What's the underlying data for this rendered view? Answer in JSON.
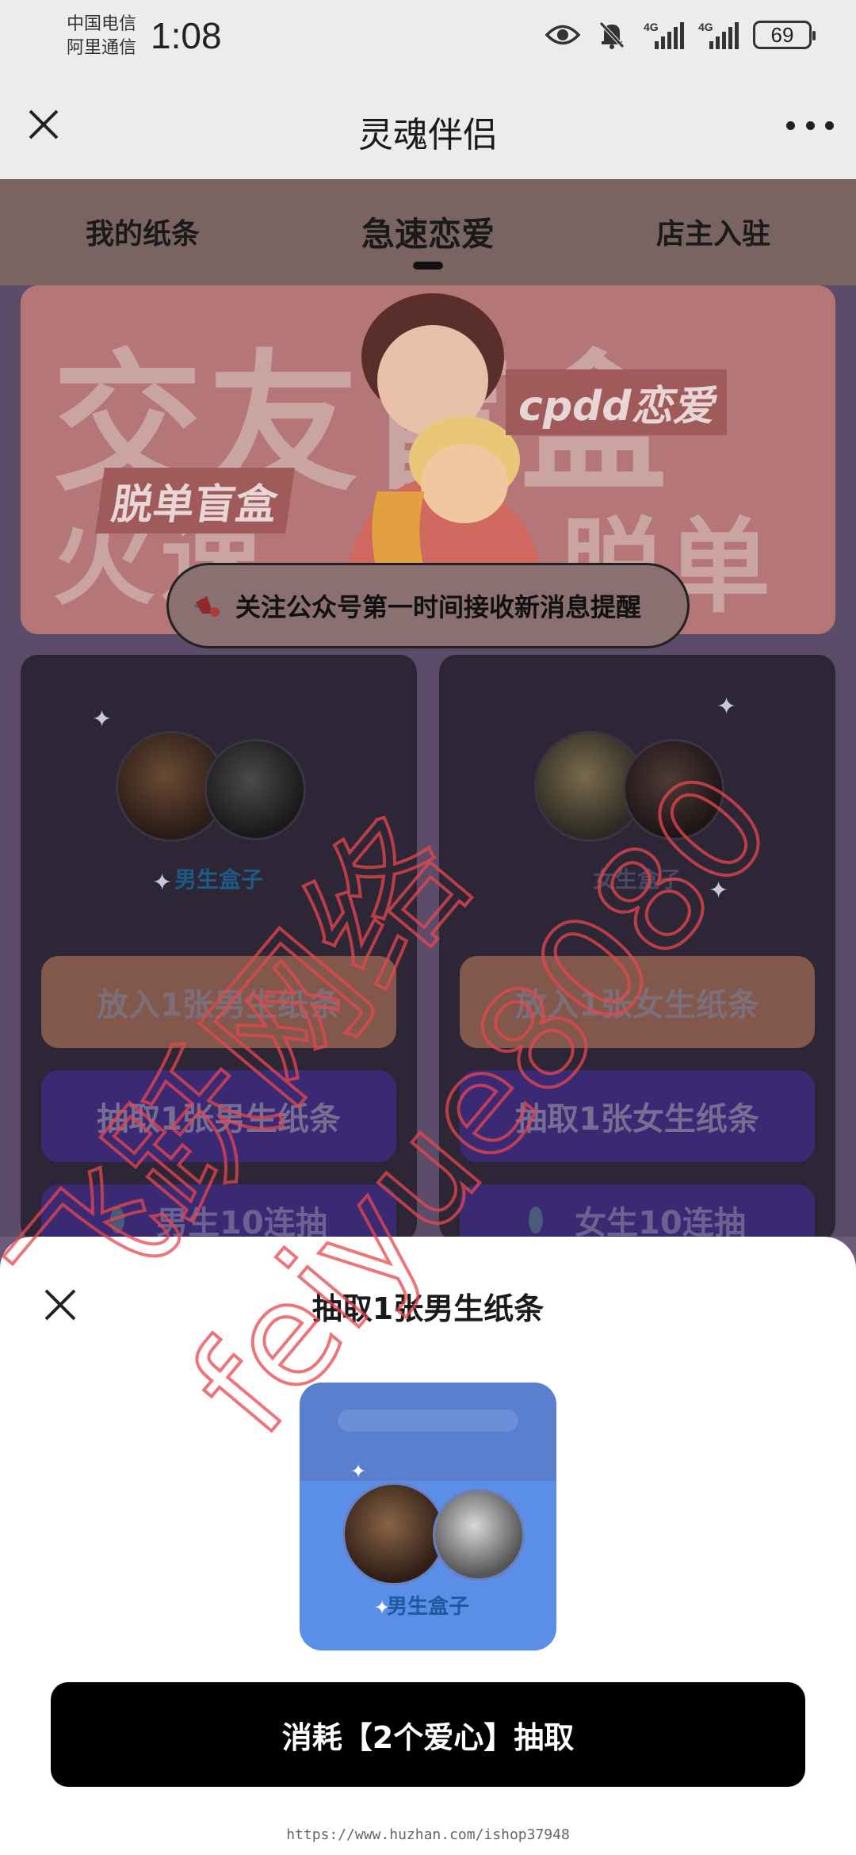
{
  "status_bar": {
    "carrier1": "中国电信",
    "carrier2": "阿里通信",
    "time": "1:08",
    "signal_tag": "4G",
    "battery": "69"
  },
  "header": {
    "title": "灵魂伴侣"
  },
  "tabs": [
    {
      "label": "我的纸条"
    },
    {
      "label": "急速恋爱"
    },
    {
      "label": "店主入驻"
    }
  ],
  "banner": {
    "big_text_1": "交友盲盒",
    "big_text_2": "火速",
    "big_text_3": "脱单",
    "tag_left": "脱单盲盒",
    "tag_right": "cpdd恋爱",
    "notice": "关注公众号第一时间接收新消息提醒"
  },
  "male_box": {
    "label": "男生盒子",
    "put_button": "放入1张男生纸条",
    "draw_button": "抽取1张男生纸条",
    "ten_button": "男生10连抽"
  },
  "female_box": {
    "label": "女生盒子",
    "put_button": "放入1张女生纸条",
    "draw_button": "抽取1张女生纸条",
    "ten_button": "女生10连抽"
  },
  "sheet": {
    "title": "抽取1张男生纸条",
    "box_label": "男生盒子",
    "action_button": "消耗【2个爱心】抽取",
    "footer_url": "https://www.huzhan.com/ishop37948"
  },
  "watermark": {
    "line1": "飞跃网络",
    "line2": "feiyue8080"
  },
  "colors": {
    "tab_bar": "#7a6462",
    "put_button": "#82584c",
    "draw_button": "#3a2a74",
    "action_button": "#000000",
    "watermark": "#e8474e"
  }
}
